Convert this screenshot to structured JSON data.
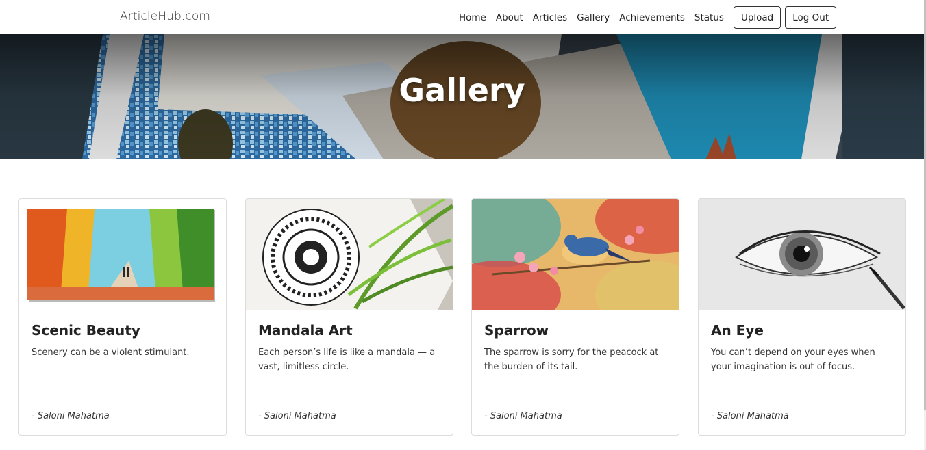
{
  "navbar": {
    "brand": "ArticleHub.com",
    "links": [
      "Home",
      "About",
      "Articles",
      "Gallery",
      "Achievements",
      "Status"
    ],
    "upload_label": "Upload",
    "logout_label": "Log Out"
  },
  "hero": {
    "title": "Gallery"
  },
  "cards": [
    {
      "title": "Scenic Beauty",
      "text": "Scenery can be a violent stimulant.",
      "author": "- Saloni Mahatma",
      "image": "scenic-painting"
    },
    {
      "title": "Mandala Art",
      "text": "Each person’s life is like a mandala — a vast, limitless circle.",
      "author": "- Saloni Mahatma",
      "image": "mandala-drawing"
    },
    {
      "title": "Sparrow",
      "text": "The sparrow is sorry for the peacock at the burden of its tail.",
      "author": "- Saloni Mahatma",
      "image": "sparrow-painting"
    },
    {
      "title": "An Eye",
      "text": "You can’t depend on your eyes when your imagination is out of focus.",
      "author": "- Saloni Mahatma",
      "image": "eye-sketch"
    }
  ],
  "colors": {
    "text": "#212529",
    "border": "#dcdcdc",
    "background": "#ffffff"
  }
}
